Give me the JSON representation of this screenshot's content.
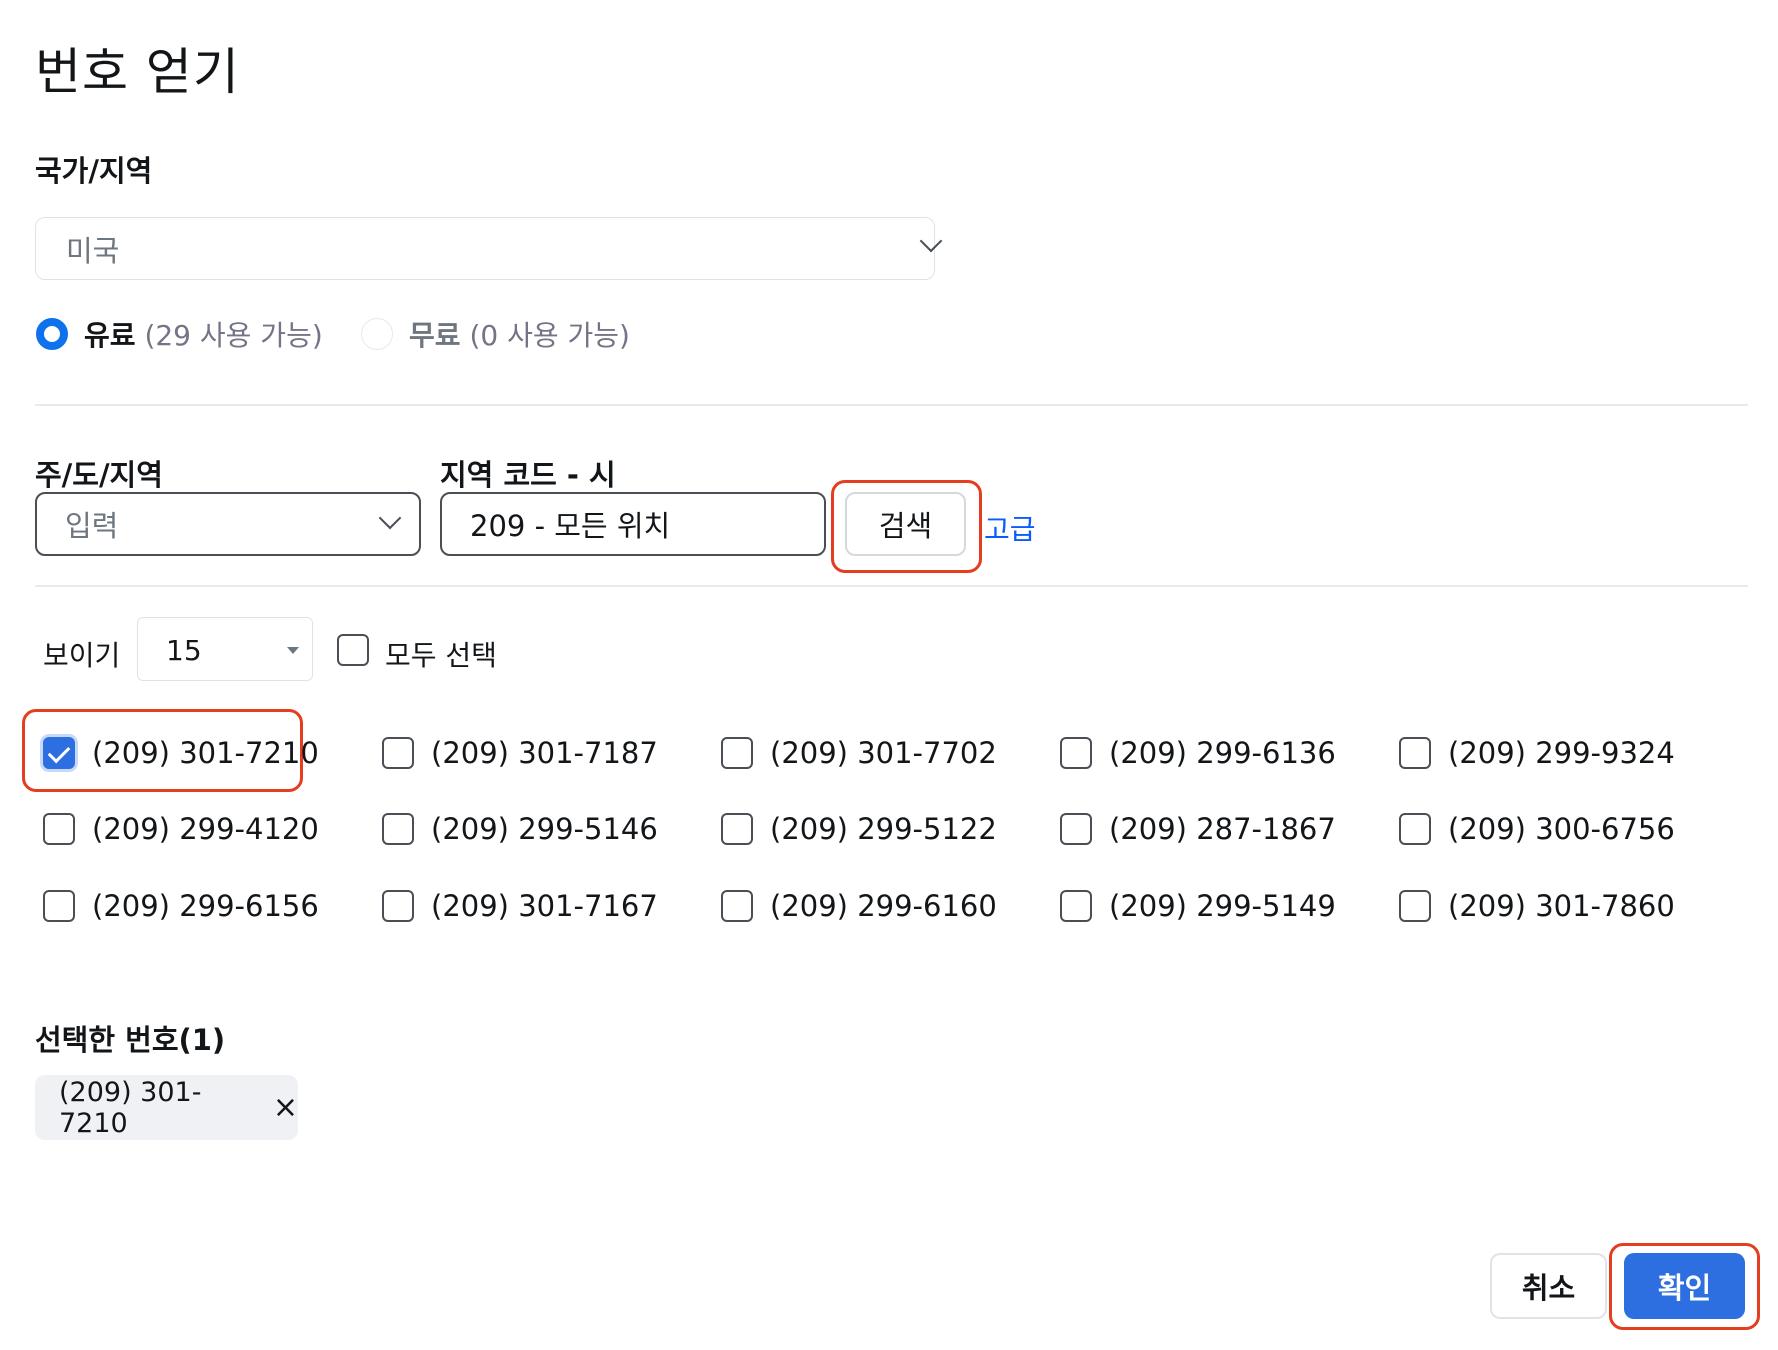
{
  "dialog": {
    "title": "번호 얻기"
  },
  "country": {
    "label": "국가/지역",
    "value": "미국"
  },
  "type_options": [
    {
      "label": "유료",
      "count": "(29 사용 가능)",
      "selected": true
    },
    {
      "label": "무료",
      "count": "(0 사용 가능)",
      "selected": false
    }
  ],
  "state": {
    "label": "주/도/지역",
    "placeholder": "입력"
  },
  "area_code": {
    "label": "지역 코드 - 시",
    "value": "209 - 모든 위치"
  },
  "search_button": "검색",
  "advanced_link": "고급",
  "show": {
    "label": "보이기",
    "value": "15"
  },
  "select_all": {
    "label": "모두 선택",
    "checked": false
  },
  "numbers": [
    {
      "number": "(209) 301-7210",
      "checked": true
    },
    {
      "number": "(209) 301-7187",
      "checked": false
    },
    {
      "number": "(209) 301-7702",
      "checked": false
    },
    {
      "number": "(209) 299-6136",
      "checked": false
    },
    {
      "number": "(209) 299-9324",
      "checked": false
    },
    {
      "number": "(209) 299-4120",
      "checked": false
    },
    {
      "number": "(209) 299-5146",
      "checked": false
    },
    {
      "number": "(209) 299-5122",
      "checked": false
    },
    {
      "number": "(209) 287-1867",
      "checked": false
    },
    {
      "number": "(209) 300-6756",
      "checked": false
    },
    {
      "number": "(209) 299-6156",
      "checked": false
    },
    {
      "number": "(209) 301-7167",
      "checked": false
    },
    {
      "number": "(209) 299-6160",
      "checked": false
    },
    {
      "number": "(209) 299-5149",
      "checked": false
    },
    {
      "number": "(209) 301-7860",
      "checked": false
    }
  ],
  "selected": {
    "label": "선택한 번호(1)",
    "chips": [
      {
        "number": "(209) 301-7210",
        "remove": "×"
      }
    ]
  },
  "footer": {
    "cancel": "취소",
    "confirm": "확인"
  },
  "colors": {
    "accent": "#2d6fe0",
    "highlight": "#e43d1f",
    "link": "#0b5cff"
  },
  "icons": {
    "dropdown": "chevron-down-icon",
    "remove": "close-icon",
    "check": "check-icon"
  }
}
